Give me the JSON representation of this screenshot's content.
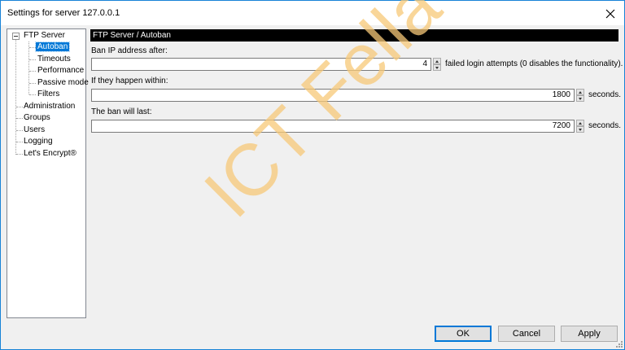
{
  "window": {
    "title": "Settings for server 127.0.0.1"
  },
  "tree": {
    "items": [
      {
        "label": "FTP Server"
      },
      {
        "label": "Autoban"
      },
      {
        "label": "Timeouts"
      },
      {
        "label": "Performance"
      },
      {
        "label": "Passive mode"
      },
      {
        "label": "Filters"
      },
      {
        "label": "Administration"
      },
      {
        "label": "Groups"
      },
      {
        "label": "Users"
      },
      {
        "label": "Logging"
      },
      {
        "label": "Let's Encrypt®"
      }
    ]
  },
  "panel": {
    "header": "FTP Server / Autoban",
    "ban_after": {
      "label": "Ban IP address after:",
      "value": "4",
      "suffix": "failed login attempts (0 disables the functionality)."
    },
    "within": {
      "label": "If they happen within:",
      "value": "1800",
      "suffix": "seconds."
    },
    "duration": {
      "label": "The ban will last:",
      "value": "7200",
      "suffix": "seconds."
    }
  },
  "buttons": {
    "ok": "OK",
    "cancel": "Cancel",
    "apply": "Apply"
  },
  "watermark": "ICT Fella",
  "colors": {
    "selection": "#0078d7",
    "header_bg": "#000000",
    "watermark": "#f7c978",
    "window_border": "#1883d7"
  }
}
